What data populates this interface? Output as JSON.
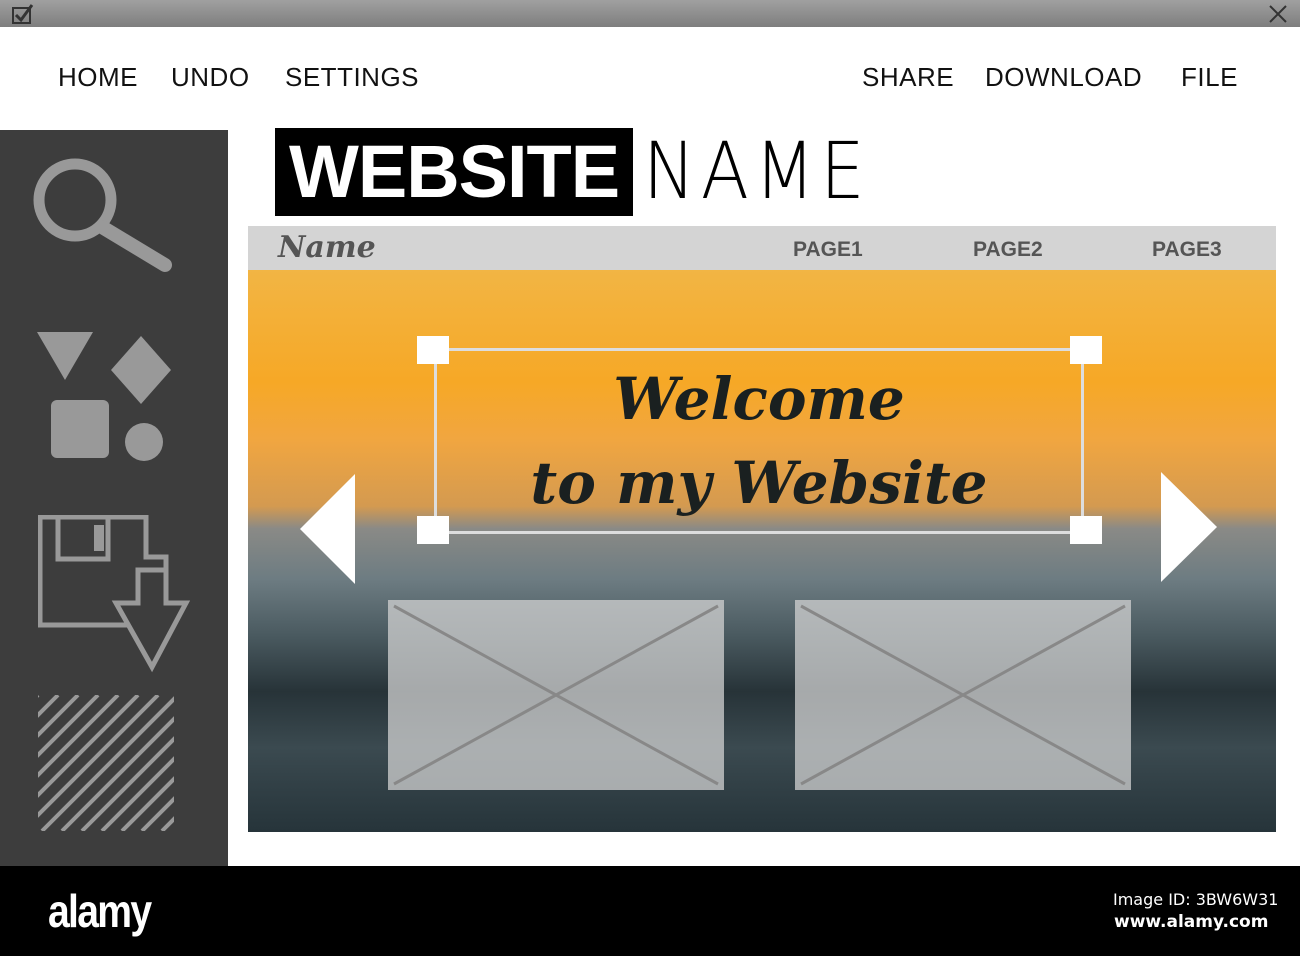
{
  "window": {
    "close_icon": "close-icon",
    "check_icon": "checkbox-icon"
  },
  "topnav": {
    "left": [
      "HOME",
      "UNDO",
      "SETTINGS"
    ],
    "right": [
      "SHARE",
      "DOWNLOAD",
      "FILE"
    ]
  },
  "logo": {
    "bold": "WEBSITE",
    "light": "NAME"
  },
  "site": {
    "name": "Name",
    "pages": [
      "PAGE1",
      "PAGE2",
      "PAGE3"
    ],
    "welcome_line1": "Welcome",
    "welcome_line2": "to my Website"
  },
  "footer": {
    "brand": "alamy",
    "image_id": "Image ID: 3BW6W31",
    "url": "www.alamy.com"
  }
}
